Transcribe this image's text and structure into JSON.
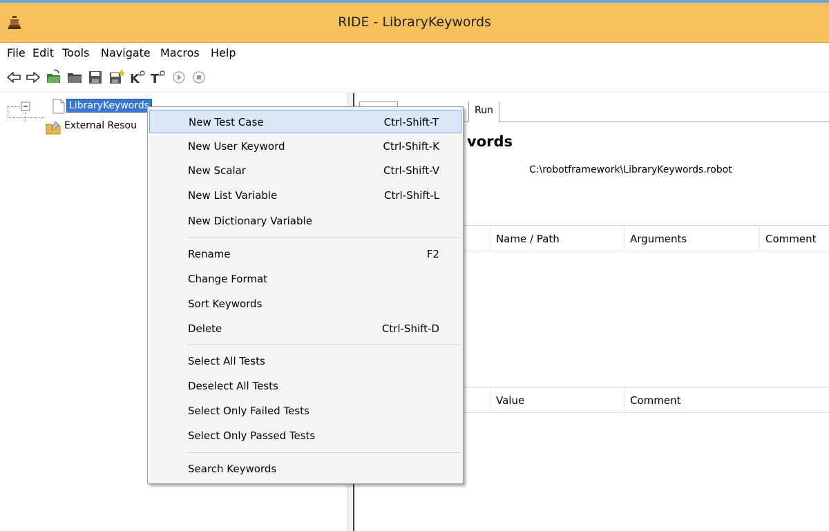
{
  "window": {
    "title": "RIDE - LibraryKeywords"
  },
  "menu": [
    "File",
    "Edit",
    "Tools",
    "Navigate",
    "Macros",
    "Help"
  ],
  "toolbar": [
    "back-icon",
    "forward-icon",
    "open-folder-icon",
    "open-directory-icon",
    "save-icon",
    "save-all-icon",
    "search-keywords-icon",
    "search-tests-icon",
    "run-icon",
    "stop-icon"
  ],
  "tree": {
    "root_label": "LibraryKeywords",
    "child_label": "External Resou"
  },
  "editor": {
    "tab_run": "Run",
    "title_fragment": "vords",
    "source_path": "C:\\robotframework\\LibraryKeywords.robot",
    "settings_headers": [
      "Name / Path",
      "Arguments",
      "Comment"
    ],
    "variables_headers": [
      "Value",
      "Comment"
    ]
  },
  "context_menu": {
    "items": [
      {
        "label": "New Test Case",
        "shortcut": "Ctrl-Shift-T",
        "highlighted": true
      },
      {
        "label": "New User Keyword",
        "shortcut": "Ctrl-Shift-K"
      },
      {
        "label": "New Scalar",
        "shortcut": "Ctrl-Shift-V"
      },
      {
        "label": "New List Variable",
        "shortcut": "Ctrl-Shift-L"
      },
      {
        "label": "New Dictionary Variable",
        "shortcut": ""
      },
      {
        "label": "Rename",
        "shortcut": "F2"
      },
      {
        "label": "Change Format",
        "shortcut": ""
      },
      {
        "label": "Sort Keywords",
        "shortcut": ""
      },
      {
        "label": "Delete",
        "shortcut": "Ctrl-Shift-D"
      },
      {
        "label": "Select All Tests",
        "shortcut": ""
      },
      {
        "label": "Deselect All Tests",
        "shortcut": ""
      },
      {
        "label": "Select Only Failed Tests",
        "shortcut": ""
      },
      {
        "label": "Select Only Passed Tests",
        "shortcut": ""
      },
      {
        "label": "Search Keywords",
        "shortcut": ""
      }
    ]
  },
  "colors": {
    "titlebar": "#f6c15c",
    "selection": "#3875d7",
    "menu_highlight": "#dbe8f7"
  }
}
